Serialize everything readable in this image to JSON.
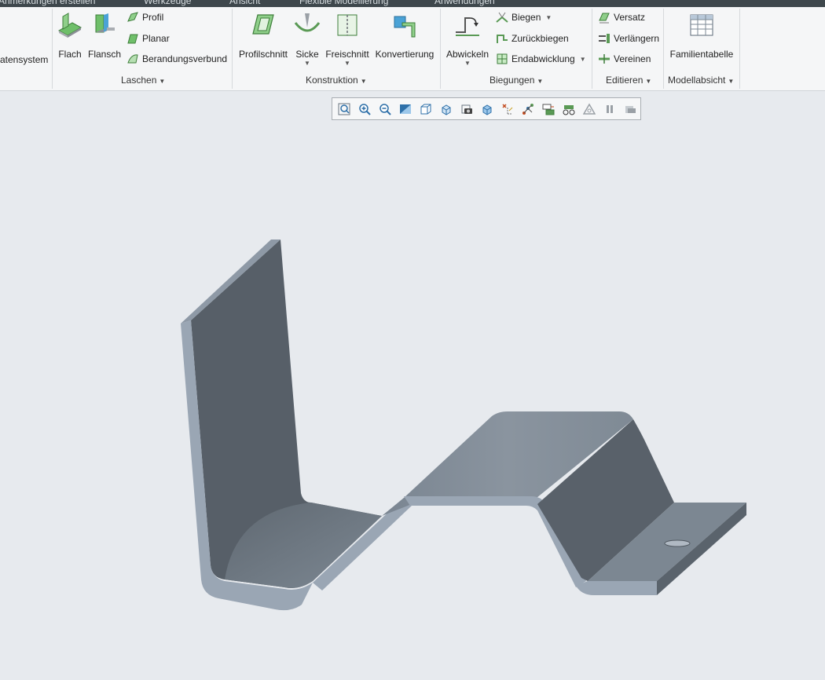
{
  "topbar": {
    "tabs": [
      "Anmerkungen erstellen",
      "Werkzeuge",
      "Ansicht",
      "Flexible Modellierung",
      "Anwendungen"
    ]
  },
  "ribbon": {
    "coord_label": "atensystem",
    "groups": {
      "laschen": {
        "label": "Laschen",
        "flach": "Flach",
        "flansch": "Flansch",
        "profil": "Profil",
        "planar": "Planar",
        "berandungsverbund": "Berandungsverbund"
      },
      "konstruktion": {
        "label": "Konstruktion",
        "profilschnitt": "Profilschnitt",
        "sicke": "Sicke",
        "freischnitt": "Freischnitt",
        "konvertierung": "Konvertierung"
      },
      "biegungen": {
        "label": "Biegungen",
        "abwickeln": "Abwickeln",
        "biegen": "Biegen",
        "zurueckbiegen": "Zurückbiegen",
        "endabwicklung": "Endabwicklung"
      },
      "editieren": {
        "label": "Editieren",
        "versatz": "Versatz",
        "verlaengern": "Verlängern",
        "vereinen": "Vereinen"
      },
      "modellabsicht": {
        "label": "Modellabsicht",
        "familientabelle": "Familientabelle"
      }
    }
  },
  "view_toolbar": {
    "buttons": [
      "refit-icon",
      "zoom-in-icon",
      "zoom-out-icon",
      "repaint-icon",
      "display-style-icon",
      "saved-orientations-icon",
      "named-views-icon",
      "view-manager-icon",
      "datum-display-icon",
      "spin-center-icon",
      "annotation-display-icon",
      "perspective-icon",
      "section-icon",
      "pause-icon",
      "appearance-icon"
    ]
  },
  "colors": {
    "background": "#e7eaee",
    "ribbon": "#f5f6f7",
    "topbar": "#3e474c",
    "sheet_dark": "#5a626b",
    "sheet_mid": "#7c8792",
    "sheet_edge": "#9aa6b4"
  }
}
